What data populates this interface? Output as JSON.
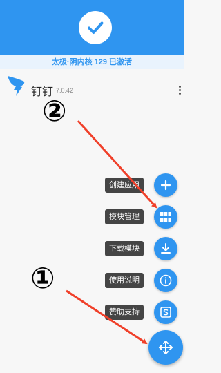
{
  "status": {
    "text": "太极·阴内核 129 已激活"
  },
  "app": {
    "name": "钉钉",
    "version": "7.0.42"
  },
  "menu": [
    {
      "label": "创建应用",
      "icon": "plus-icon"
    },
    {
      "label": "模块管理",
      "icon": "grid-icon"
    },
    {
      "label": "下载模块",
      "icon": "download-icon"
    },
    {
      "label": "使用说明",
      "icon": "info-icon"
    },
    {
      "label": "赞助支持",
      "icon": "sponsor-icon"
    }
  ],
  "fab": {
    "icon": "move-arrows-icon"
  },
  "annotations": [
    {
      "label": "①"
    },
    {
      "label": "②"
    }
  ],
  "colors": {
    "accent": "#2f95f0",
    "arrow": "#f0402a",
    "label_bg": "#454545"
  }
}
